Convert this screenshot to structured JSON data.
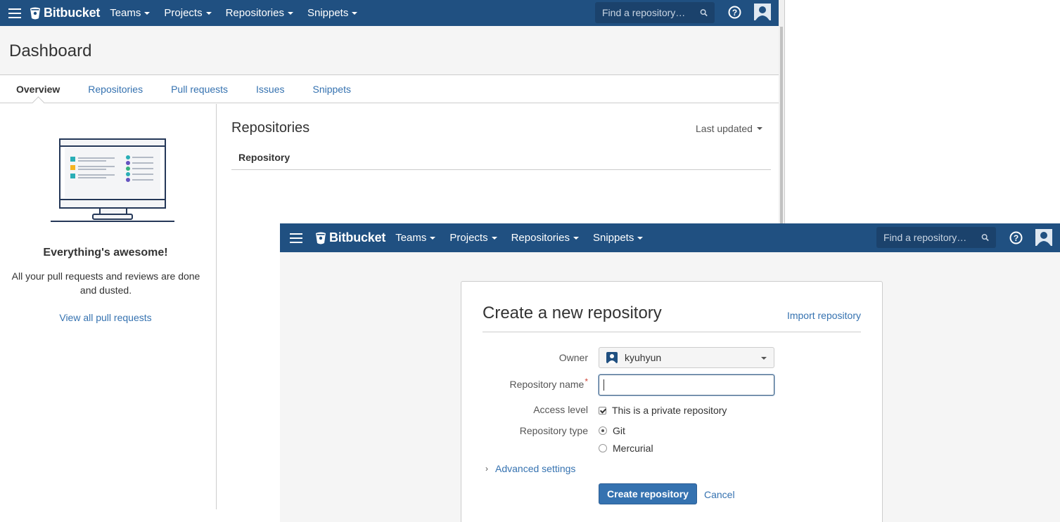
{
  "brand": {
    "name": "Bitbucket",
    "color": "#205081",
    "link_color": "#3572b0",
    "button_color": "#3572b0"
  },
  "nav": {
    "items": [
      "Teams",
      "Projects",
      "Repositories",
      "Snippets"
    ],
    "search_placeholder": "Find a repository…",
    "icons": {
      "menu": "hamburger-icon",
      "search": "search-icon",
      "help": "help-icon",
      "avatar": "user-avatar-icon"
    }
  },
  "dashboard": {
    "title": "Dashboard",
    "tabs": [
      "Overview",
      "Repositories",
      "Pull requests",
      "Issues",
      "Snippets"
    ],
    "active_tab": "Overview",
    "empty_state": {
      "heading": "Everything's awesome!",
      "message": "All your pull requests and reviews are done and dusted.",
      "link": "View all pull requests"
    },
    "repositories": {
      "heading": "Repositories",
      "sort_label": "Last updated",
      "column_header": "Repository"
    }
  },
  "create_repo": {
    "title": "Create a new repository",
    "import_link": "Import repository",
    "owner": {
      "label": "Owner",
      "value": "kyuhyun"
    },
    "repo_name": {
      "label": "Repository name",
      "required_marker": "*",
      "value": ""
    },
    "access_level": {
      "label": "Access level",
      "checkbox_label": "This is a private repository",
      "checked": true
    },
    "repo_type": {
      "label": "Repository type",
      "options": [
        "Git",
        "Mercurial"
      ],
      "selected": "Git"
    },
    "advanced": "Advanced settings",
    "submit": "Create repository",
    "cancel": "Cancel"
  }
}
